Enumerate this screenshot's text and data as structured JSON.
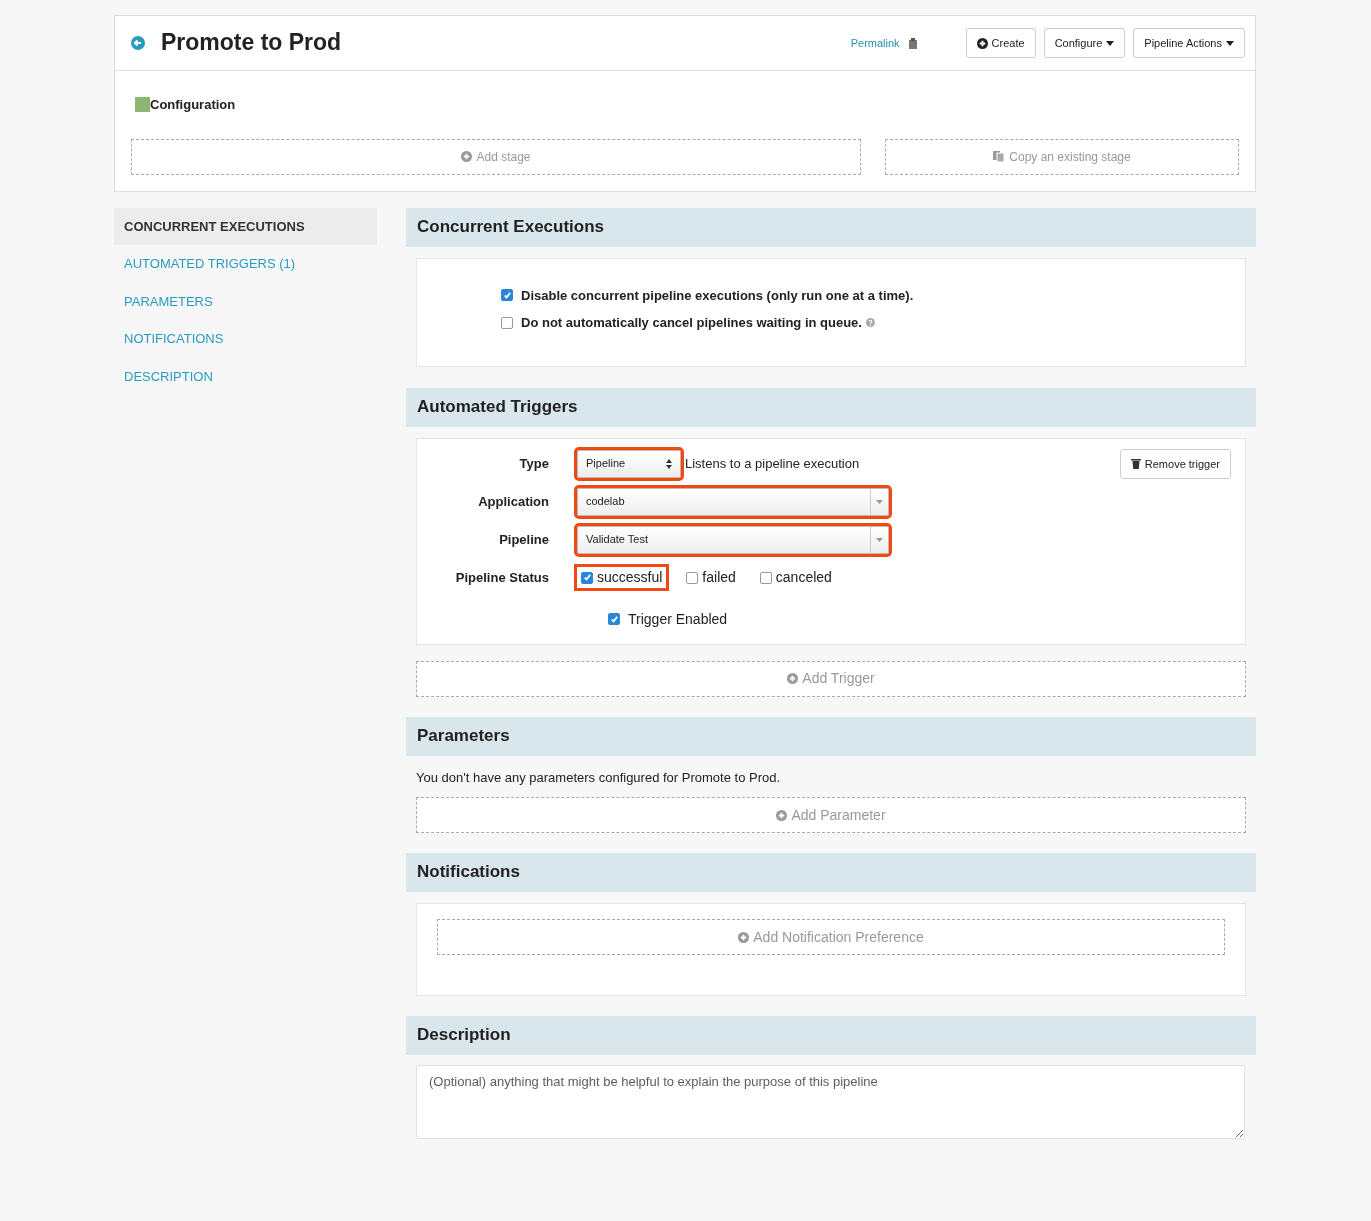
{
  "header": {
    "title": "Promote to Prod",
    "permalink": "Permalink",
    "buttons": [
      {
        "label": "Create",
        "kind": "create"
      },
      {
        "label": "Configure",
        "kind": "dropdown"
      },
      {
        "label": "Pipeline Actions",
        "kind": "dropdown"
      }
    ]
  },
  "stages": {
    "current": "Configuration",
    "add_stage": "Add stage",
    "copy_stage": "Copy an existing stage"
  },
  "sidebar": {
    "items": [
      {
        "label": "CONCURRENT EXECUTIONS",
        "selected": true
      },
      {
        "label": "AUTOMATED TRIGGERS (1)",
        "selected": false
      },
      {
        "label": "PARAMETERS",
        "selected": false
      },
      {
        "label": "NOTIFICATIONS",
        "selected": false
      },
      {
        "label": "DESCRIPTION",
        "selected": false
      }
    ]
  },
  "concurrent": {
    "title": "Concurrent Executions",
    "options": [
      {
        "label": "Disable concurrent pipeline executions (only run one at a time).",
        "checked": true,
        "help": false
      },
      {
        "label": "Do not automatically cancel pipelines waiting in queue.",
        "checked": false,
        "help": true
      }
    ]
  },
  "triggers": {
    "title": "Automated Triggers",
    "type": {
      "label": "Type",
      "value": "Pipeline",
      "description": "Listens to a pipeline execution",
      "highlighted": true
    },
    "application": {
      "label": "Application",
      "value": "codelab",
      "highlighted": true
    },
    "pipeline": {
      "label": "Pipeline",
      "value": "Validate Test",
      "highlighted": true
    },
    "status": {
      "label": "Pipeline Status",
      "options": [
        {
          "label": "successful",
          "checked": true,
          "highlighted": true
        },
        {
          "label": "failed",
          "checked": false,
          "highlighted": false
        },
        {
          "label": "canceled",
          "checked": false,
          "highlighted": false
        }
      ]
    },
    "enabled": {
      "label": "Trigger Enabled",
      "checked": true
    },
    "remove": "Remove trigger",
    "add": "Add Trigger"
  },
  "parameters": {
    "title": "Parameters",
    "message": "You don't have any parameters configured for Promote to Prod.",
    "add": "Add Parameter"
  },
  "notifications": {
    "title": "Notifications",
    "add": "Add Notification Preference"
  },
  "description": {
    "title": "Description",
    "placeholder": "(Optional) anything that might be helpful to explain the purpose of this pipeline"
  }
}
